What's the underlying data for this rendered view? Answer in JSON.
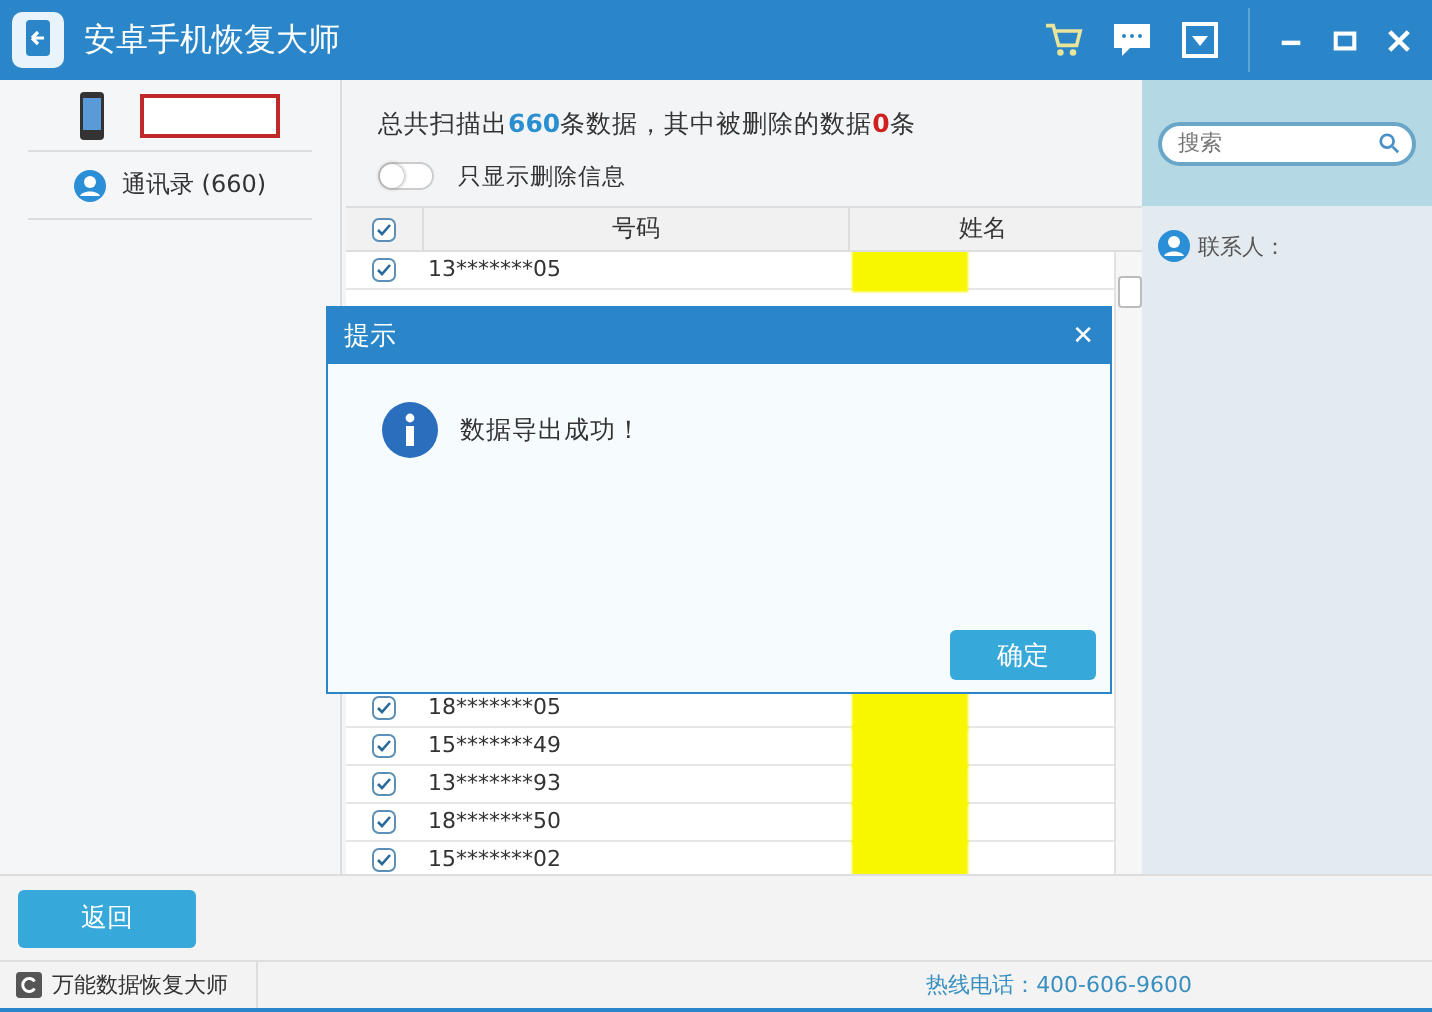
{
  "window": {
    "title": "安卓手机恢复大师"
  },
  "sidebar": {
    "items": [
      {
        "label": "通讯录 (660)",
        "selected": false
      }
    ]
  },
  "summary": {
    "text": "总共扫描出**660**条数据，其中被删除的数据**0**条"
  },
  "filter": {
    "label": "只显示删除信息",
    "on": false
  },
  "table": {
    "columns": [
      "号码",
      "姓名"
    ],
    "all_checked": true,
    "rows": [
      {
        "number": "13*******05",
        "checked": true
      },
      {
        "number": "18*******05",
        "checked": true
      },
      {
        "number": "15*******49",
        "checked": true
      },
      {
        "number": "13*******93",
        "checked": true
      },
      {
        "number": "18*******50",
        "checked": true
      },
      {
        "number": "15*******02",
        "checked": true
      }
    ]
  },
  "right_panel": {
    "search": {
      "placeholder": "搜索"
    },
    "contact_label": "联系人："
  },
  "dialog": {
    "title": "提示",
    "close": "✕",
    "message": "数据导出成功！",
    "button": "确定"
  },
  "back_button": "返回",
  "status_bar": {
    "left": "万能数据恢复大师",
    "right": "热线电话：400-606-9600"
  }
}
